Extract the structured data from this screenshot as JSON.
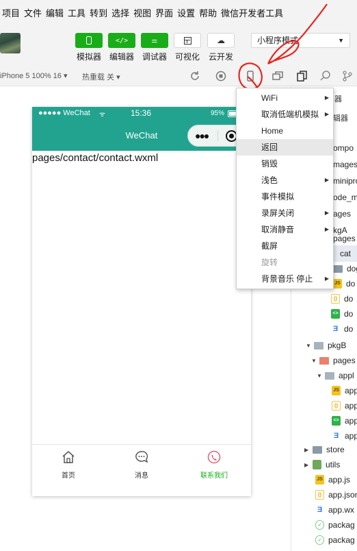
{
  "menubar": {
    "items": [
      "项目",
      "文件",
      "编辑",
      "工具",
      "转到",
      "选择",
      "视图",
      "界面",
      "设置",
      "帮助",
      "微信开发者工具"
    ]
  },
  "toolbar": {
    "simulator_label": "模拟器",
    "editor_label": "编辑器",
    "debugger_label": "调试器",
    "visual_label": "可视化",
    "cloud_label": "云开发",
    "mode_select": "小程序模式",
    "accent_color": "#1aad19"
  },
  "subbar": {
    "device": "iPhone 5 100% 16 ▾",
    "hot_reload": "热重载 关 ▾"
  },
  "phone": {
    "status_left": "●●●●● WeChat",
    "status_time": "15:36",
    "status_battery": "95%",
    "nav_title": "WeChat",
    "page_text": "pages/contact/contact.wxml",
    "nav_color": "#21a38f",
    "tabs": [
      {
        "label": "首页",
        "color": "#333333"
      },
      {
        "label": "消息",
        "color": "#333333"
      },
      {
        "label": "联系我们",
        "color": "#1aad19"
      }
    ]
  },
  "context_menu": {
    "items": [
      {
        "label": "WiFi",
        "submenu": true,
        "highlight": false,
        "disabled": false
      },
      {
        "label": "取消低端机模拟",
        "submenu": true,
        "highlight": false,
        "disabled": false
      },
      {
        "label": "Home",
        "submenu": false,
        "highlight": false,
        "disabled": false
      },
      {
        "label": "返回",
        "submenu": false,
        "highlight": true,
        "disabled": false
      },
      {
        "label": "销毁",
        "submenu": false,
        "highlight": false,
        "disabled": false
      },
      {
        "label": "浅色",
        "submenu": true,
        "highlight": false,
        "disabled": false
      },
      {
        "label": "事件模拟",
        "submenu": false,
        "highlight": false,
        "disabled": false
      },
      {
        "label": "录屏关闭",
        "submenu": true,
        "highlight": false,
        "disabled": false
      },
      {
        "label": "取消静音",
        "submenu": true,
        "highlight": false,
        "disabled": false
      },
      {
        "label": "截屏",
        "submenu": false,
        "highlight": false,
        "disabled": false
      },
      {
        "label": "旋转",
        "submenu": false,
        "highlight": false,
        "disabled": true
      },
      {
        "label": "背景音乐 停止",
        "submenu": true,
        "highlight": false,
        "disabled": false
      }
    ]
  },
  "tree": {
    "header": "器",
    "header2": "辑器",
    "rows": [
      {
        "label": "ompo",
        "icon": "folder"
      },
      {
        "label": "mages",
        "icon": "folder"
      },
      {
        "label": "minipro",
        "icon": "folder"
      },
      {
        "label": "ode_m",
        "icon": "folder"
      },
      {
        "label": "ages",
        "icon": "folder"
      },
      {
        "label": "kgA",
        "icon": "folder"
      },
      {
        "label": "pages",
        "icon": "folder"
      },
      {
        "label": "cat",
        "icon": "folder"
      },
      {
        "label": "dog",
        "icon": "folder"
      },
      {
        "label": "do",
        "icon": "js"
      },
      {
        "label": "do",
        "icon": "json"
      },
      {
        "label": "do",
        "icon": "wxml"
      },
      {
        "label": "do",
        "icon": "wxss"
      },
      {
        "label": "pkgB",
        "icon": "folder"
      },
      {
        "label": "pages",
        "icon": "folder-red"
      },
      {
        "label": "appl",
        "icon": "folder"
      },
      {
        "label": "app",
        "icon": "js"
      },
      {
        "label": "app",
        "icon": "json"
      },
      {
        "label": "app",
        "icon": "wxml"
      },
      {
        "label": "app",
        "icon": "wxss"
      },
      {
        "label": "store",
        "icon": "folder"
      },
      {
        "label": "utils",
        "icon": "utils"
      },
      {
        "label": "app.js",
        "icon": "js"
      },
      {
        "label": "app.json",
        "icon": "json"
      },
      {
        "label": "app.wx",
        "icon": "wxss"
      },
      {
        "label": "packag",
        "icon": "pkg"
      },
      {
        "label": "packag",
        "icon": "pkg"
      }
    ]
  }
}
